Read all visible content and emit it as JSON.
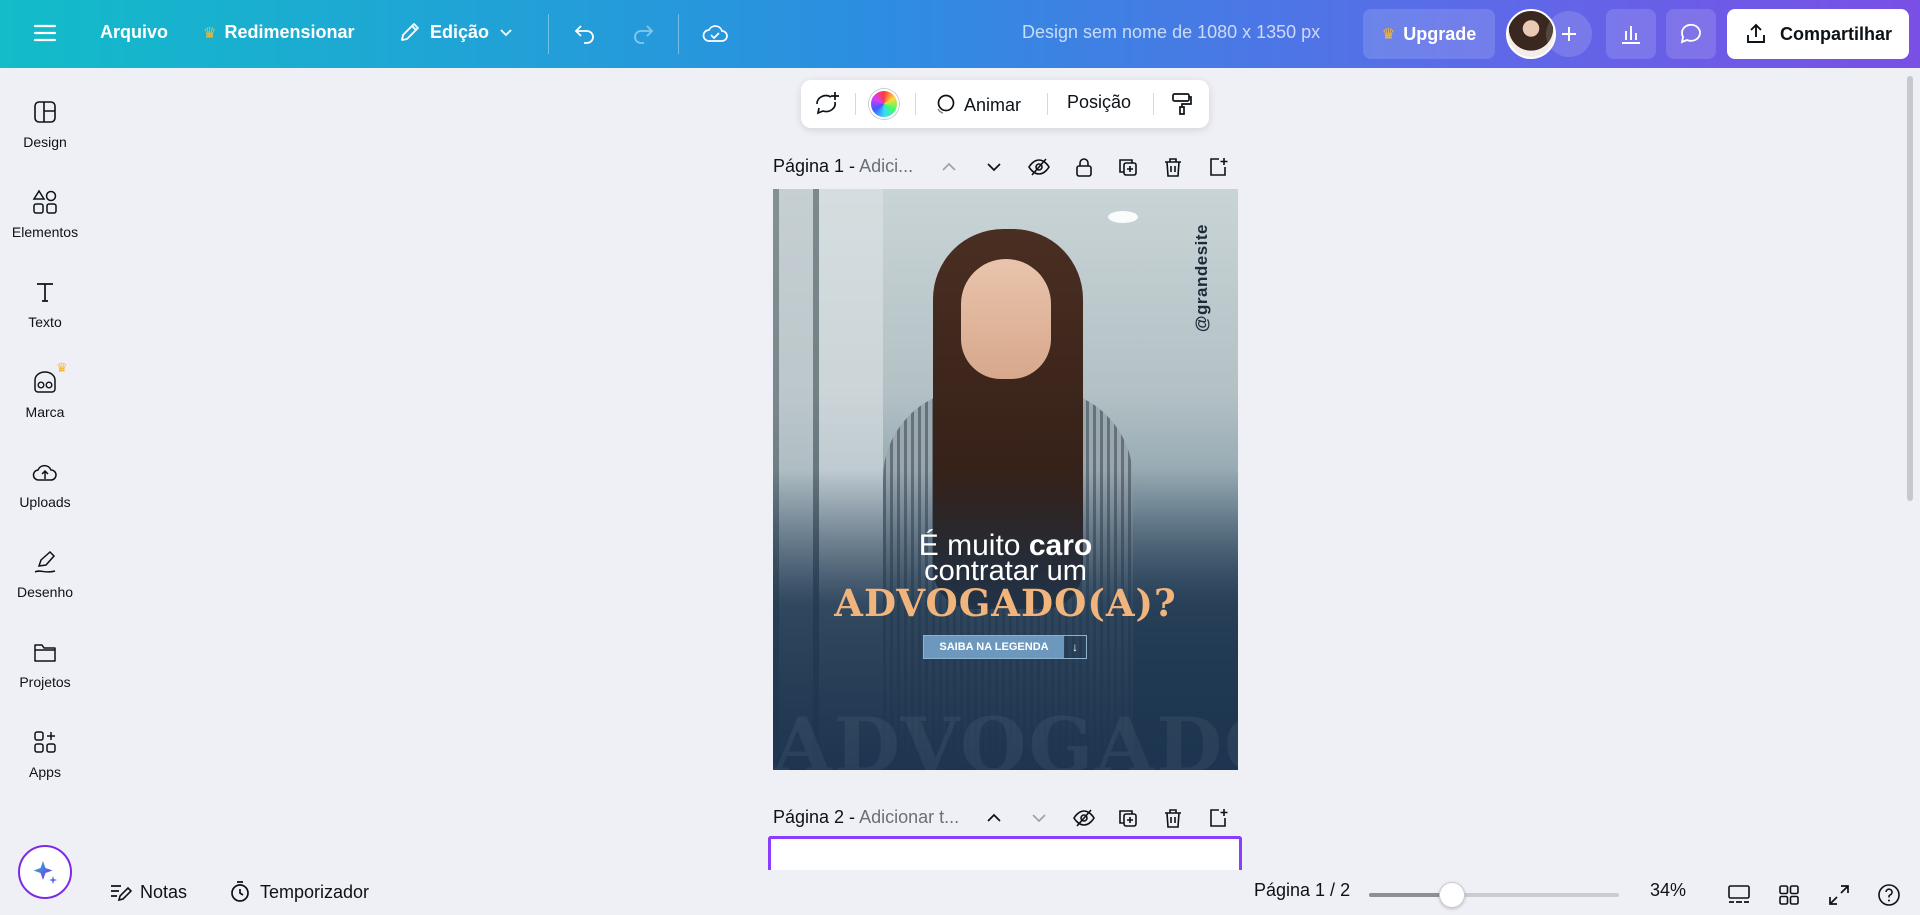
{
  "topbar": {
    "menu_icon": "hamburger-menu-icon",
    "file_label": "Arquivo",
    "resize_label": "Redimensionar",
    "edit_label": "Edição",
    "design_title": "Design sem nome de 1080 x 1350 px",
    "upgrade_label": "Upgrade",
    "share_label": "Compartilhar"
  },
  "sidebar": {
    "items": [
      {
        "label": "Design",
        "icon": "layout-icon"
      },
      {
        "label": "Elementos",
        "icon": "shapes-icon"
      },
      {
        "label": "Texto",
        "icon": "text-icon"
      },
      {
        "label": "Marca",
        "icon": "brand-icon"
      },
      {
        "label": "Uploads",
        "icon": "cloud-upload-icon"
      },
      {
        "label": "Desenho",
        "icon": "draw-icon"
      },
      {
        "label": "Projetos",
        "icon": "folder-icon"
      },
      {
        "label": "Apps",
        "icon": "apps-icon"
      }
    ]
  },
  "float_toolbar": {
    "animate_label": "Animar",
    "position_label": "Posição"
  },
  "pages": {
    "page1_title": "Página 1 -",
    "page1_sub": "Adici...",
    "page2_title": "Página 2 -",
    "page2_sub": "Adicionar t..."
  },
  "design": {
    "handle": "@grandesite",
    "line1_pre": "É muito ",
    "line1_bold": "caro",
    "line2": "contratar um",
    "line3": "ADVOGADO(A)?",
    "cta": "SAIBA NA LEGENDA",
    "cta_arrow": "↓",
    "bg_word": "ADVOGADO",
    "accent_color": "#f0b47c"
  },
  "bottombar": {
    "notes_label": "Notas",
    "timer_label": "Temporizador",
    "page_counter": "Página 1 / 2",
    "zoom": "34%",
    "zoom_fraction": 0.33
  },
  "colors": {
    "brand_purple": "#8b3dff",
    "crown": "#f7b731"
  }
}
